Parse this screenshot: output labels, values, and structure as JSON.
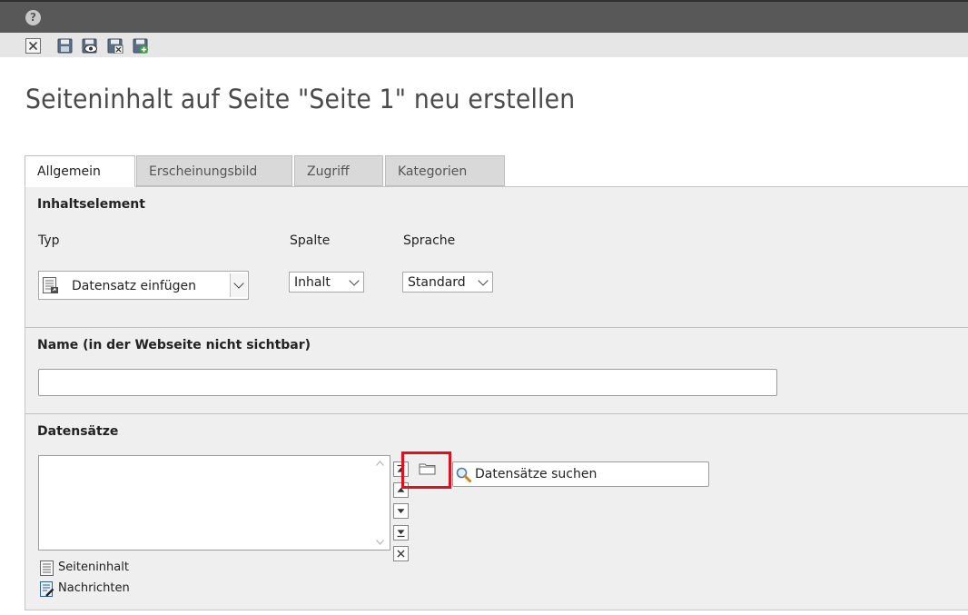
{
  "toolbar": {
    "icons": [
      "close-icon",
      "save-icon",
      "save-view-icon",
      "save-close-icon",
      "save-new-icon"
    ]
  },
  "page": {
    "title": "Seiteninhalt auf Seite \"Seite 1\" neu erstellen"
  },
  "tabs": [
    {
      "label": "Allgemein",
      "active": true
    },
    {
      "label": "Erscheinungsbild",
      "active": false
    },
    {
      "label": "Zugriff",
      "active": false
    },
    {
      "label": "Kategorien",
      "active": false
    }
  ],
  "content_element": {
    "heading": "Inhaltselement",
    "typ_label": "Typ",
    "typ_value": "Datensatz einfügen",
    "spalte_label": "Spalte",
    "spalte_value": "Inhalt",
    "sprache_label": "Sprache",
    "sprache_value": "Standard"
  },
  "name_section": {
    "heading": "Name (in der Webseite nicht sichtbar)",
    "value": ""
  },
  "records": {
    "heading": "Datensätze",
    "search_label": "Datensätze suchen",
    "allowed_tables": [
      "Seiteninhalt",
      "Nachrichten"
    ]
  },
  "colors": {
    "topbar": "#585858",
    "toolbar": "#e6e6e6",
    "panel": "#efefef",
    "highlight": "#e0101e"
  }
}
